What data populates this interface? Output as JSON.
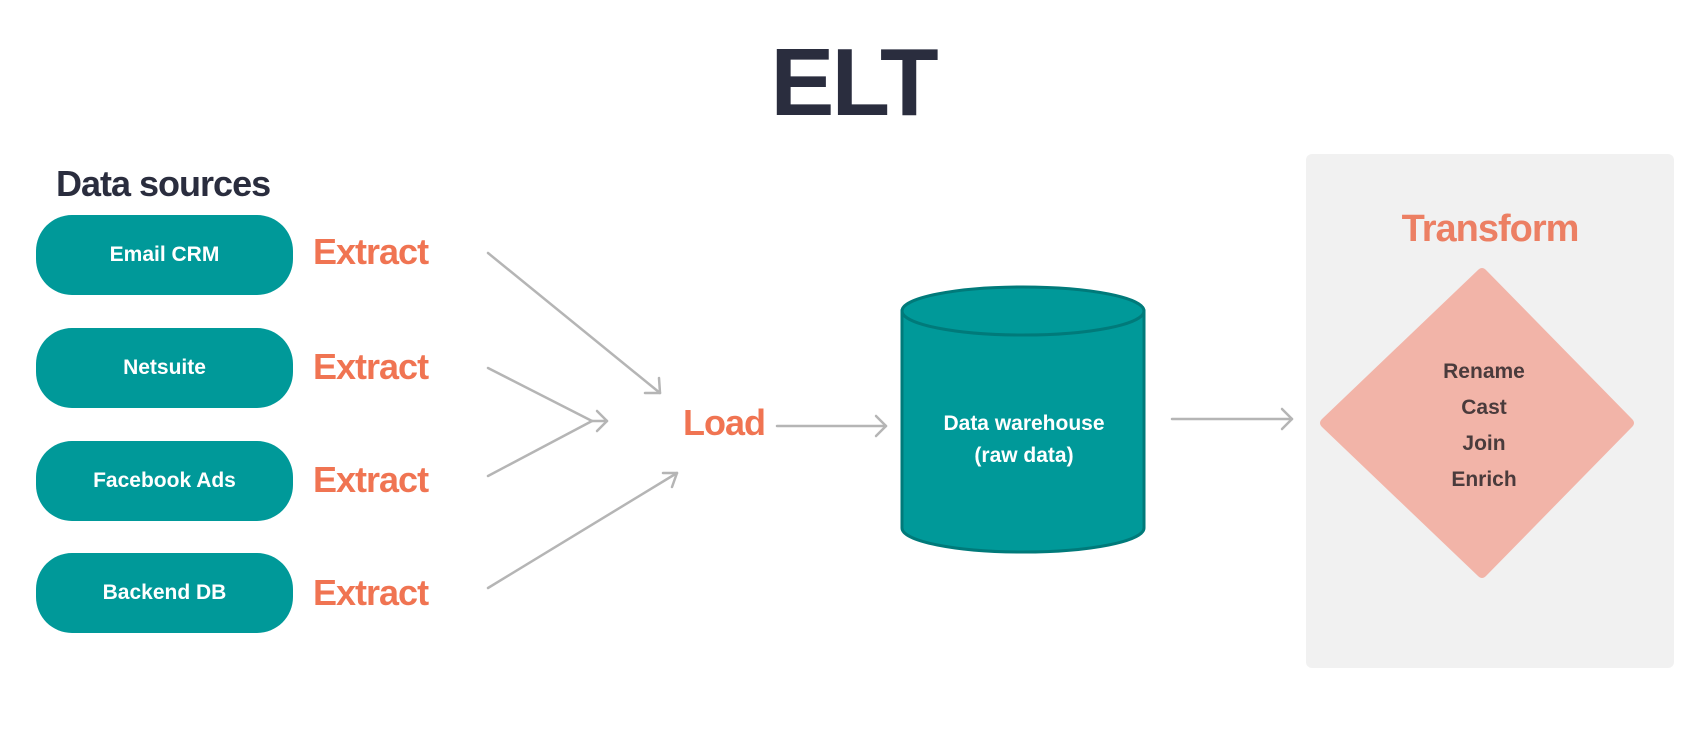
{
  "title": "ELT",
  "sources": {
    "heading": "Data sources",
    "items": [
      {
        "label": "Email CRM",
        "action": "Extract"
      },
      {
        "label": "Netsuite",
        "action": "Extract"
      },
      {
        "label": "Facebook Ads",
        "action": "Extract"
      },
      {
        "label": "Backend DB",
        "action": "Extract"
      }
    ]
  },
  "load": {
    "label": "Load"
  },
  "warehouse": {
    "line1": "Data warehouse",
    "line2": "(raw data)"
  },
  "transform": {
    "title": "Transform",
    "steps": [
      "Rename",
      "Cast",
      "Join",
      "Enrich"
    ]
  },
  "colors": {
    "teal": "#009999",
    "teal_dark": "#007a7a",
    "orange": "#f07452",
    "salmon": "#f2b4a8",
    "navy": "#2a2d3e",
    "arrow_gray": "#b5b5b5",
    "panel_gray": "#f1f1f1"
  }
}
